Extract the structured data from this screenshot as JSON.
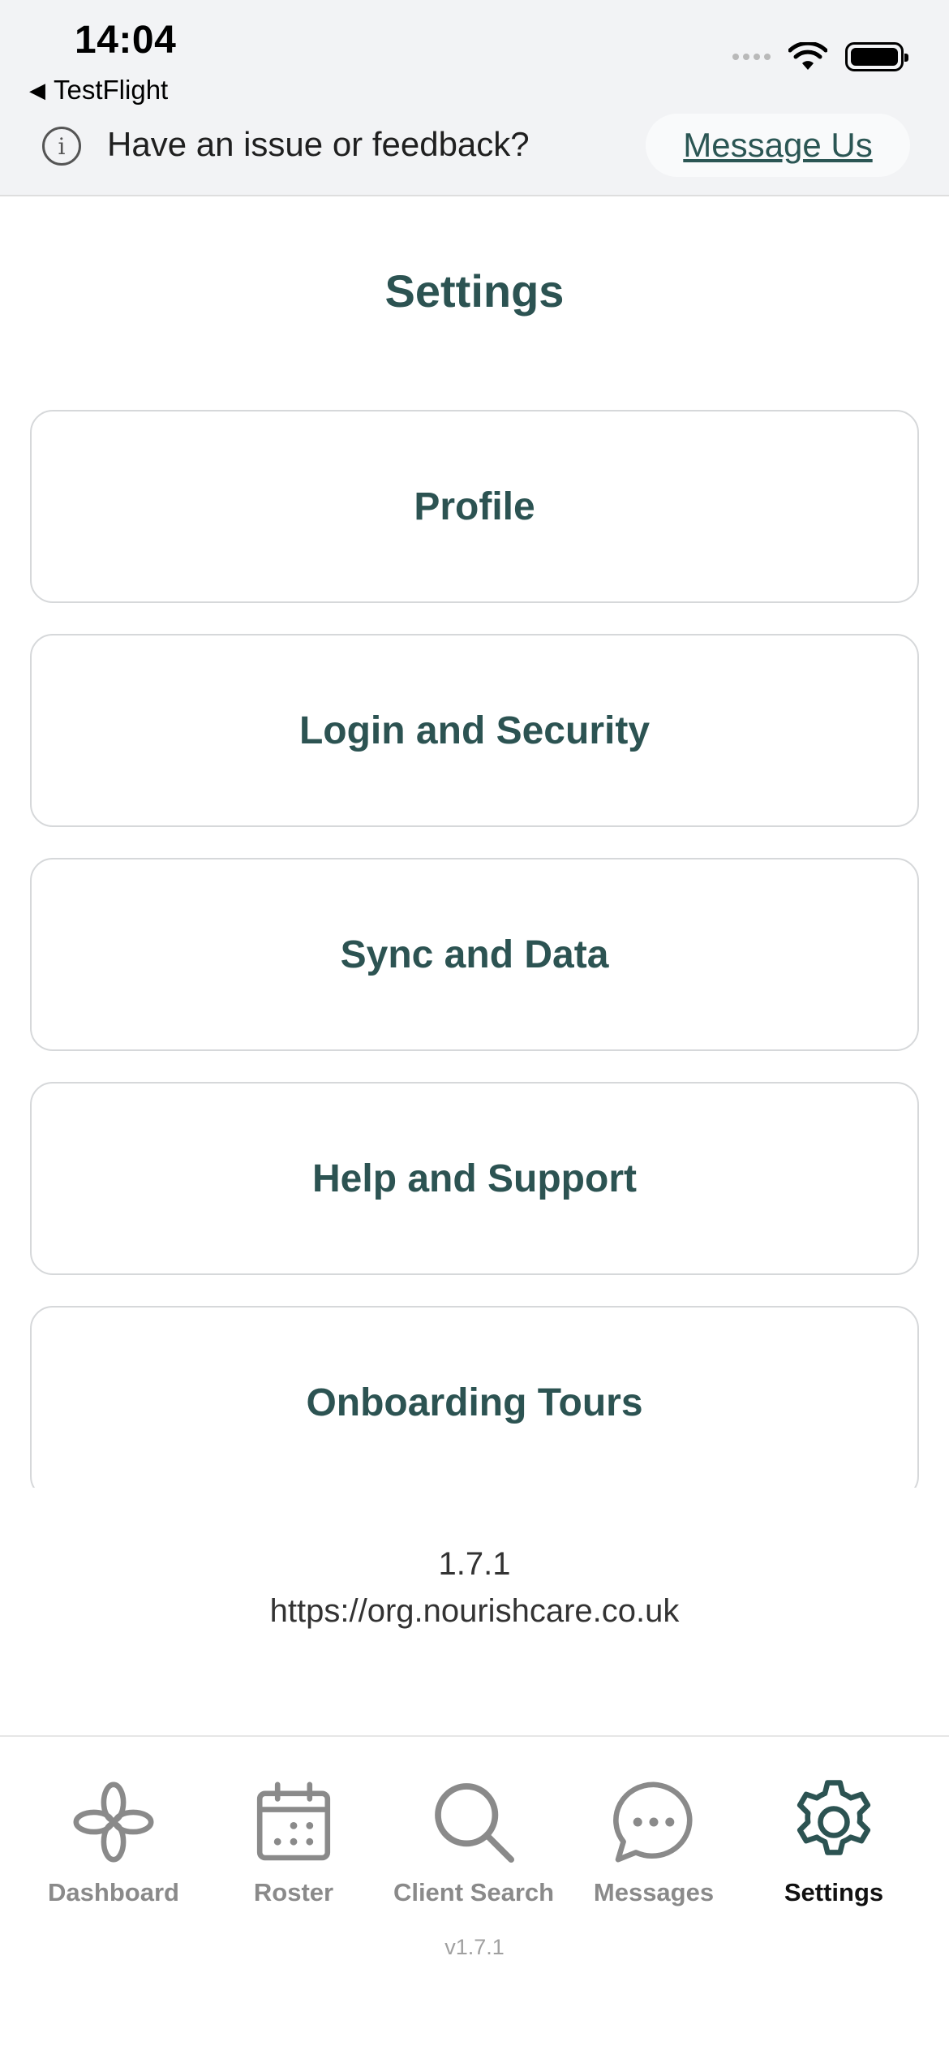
{
  "status_bar": {
    "time": "14:04",
    "back_app": "TestFlight"
  },
  "feedback": {
    "text": "Have an issue or feedback?",
    "button": "Message Us"
  },
  "page": {
    "title": "Settings"
  },
  "settings_items": [
    {
      "label": "Profile"
    },
    {
      "label": "Login and Security"
    },
    {
      "label": "Sync and Data"
    },
    {
      "label": "Help and Support"
    },
    {
      "label": "Onboarding Tours"
    }
  ],
  "footer": {
    "version": "1.7.1",
    "url": "https://org.nourishcare.co.uk"
  },
  "tabs": [
    {
      "label": "Dashboard",
      "icon": "flower-icon",
      "active": false
    },
    {
      "label": "Roster",
      "icon": "calendar-icon",
      "active": false
    },
    {
      "label": "Client Search",
      "icon": "search-icon",
      "active": false
    },
    {
      "label": "Messages",
      "icon": "chat-icon",
      "active": false
    },
    {
      "label": "Settings",
      "icon": "gear-icon",
      "active": true
    }
  ],
  "tab_version": "v1.7.1",
  "colors": {
    "brand": "#2c5352",
    "inactive": "#8a8a8a",
    "banner_bg": "#f2f3f5"
  }
}
